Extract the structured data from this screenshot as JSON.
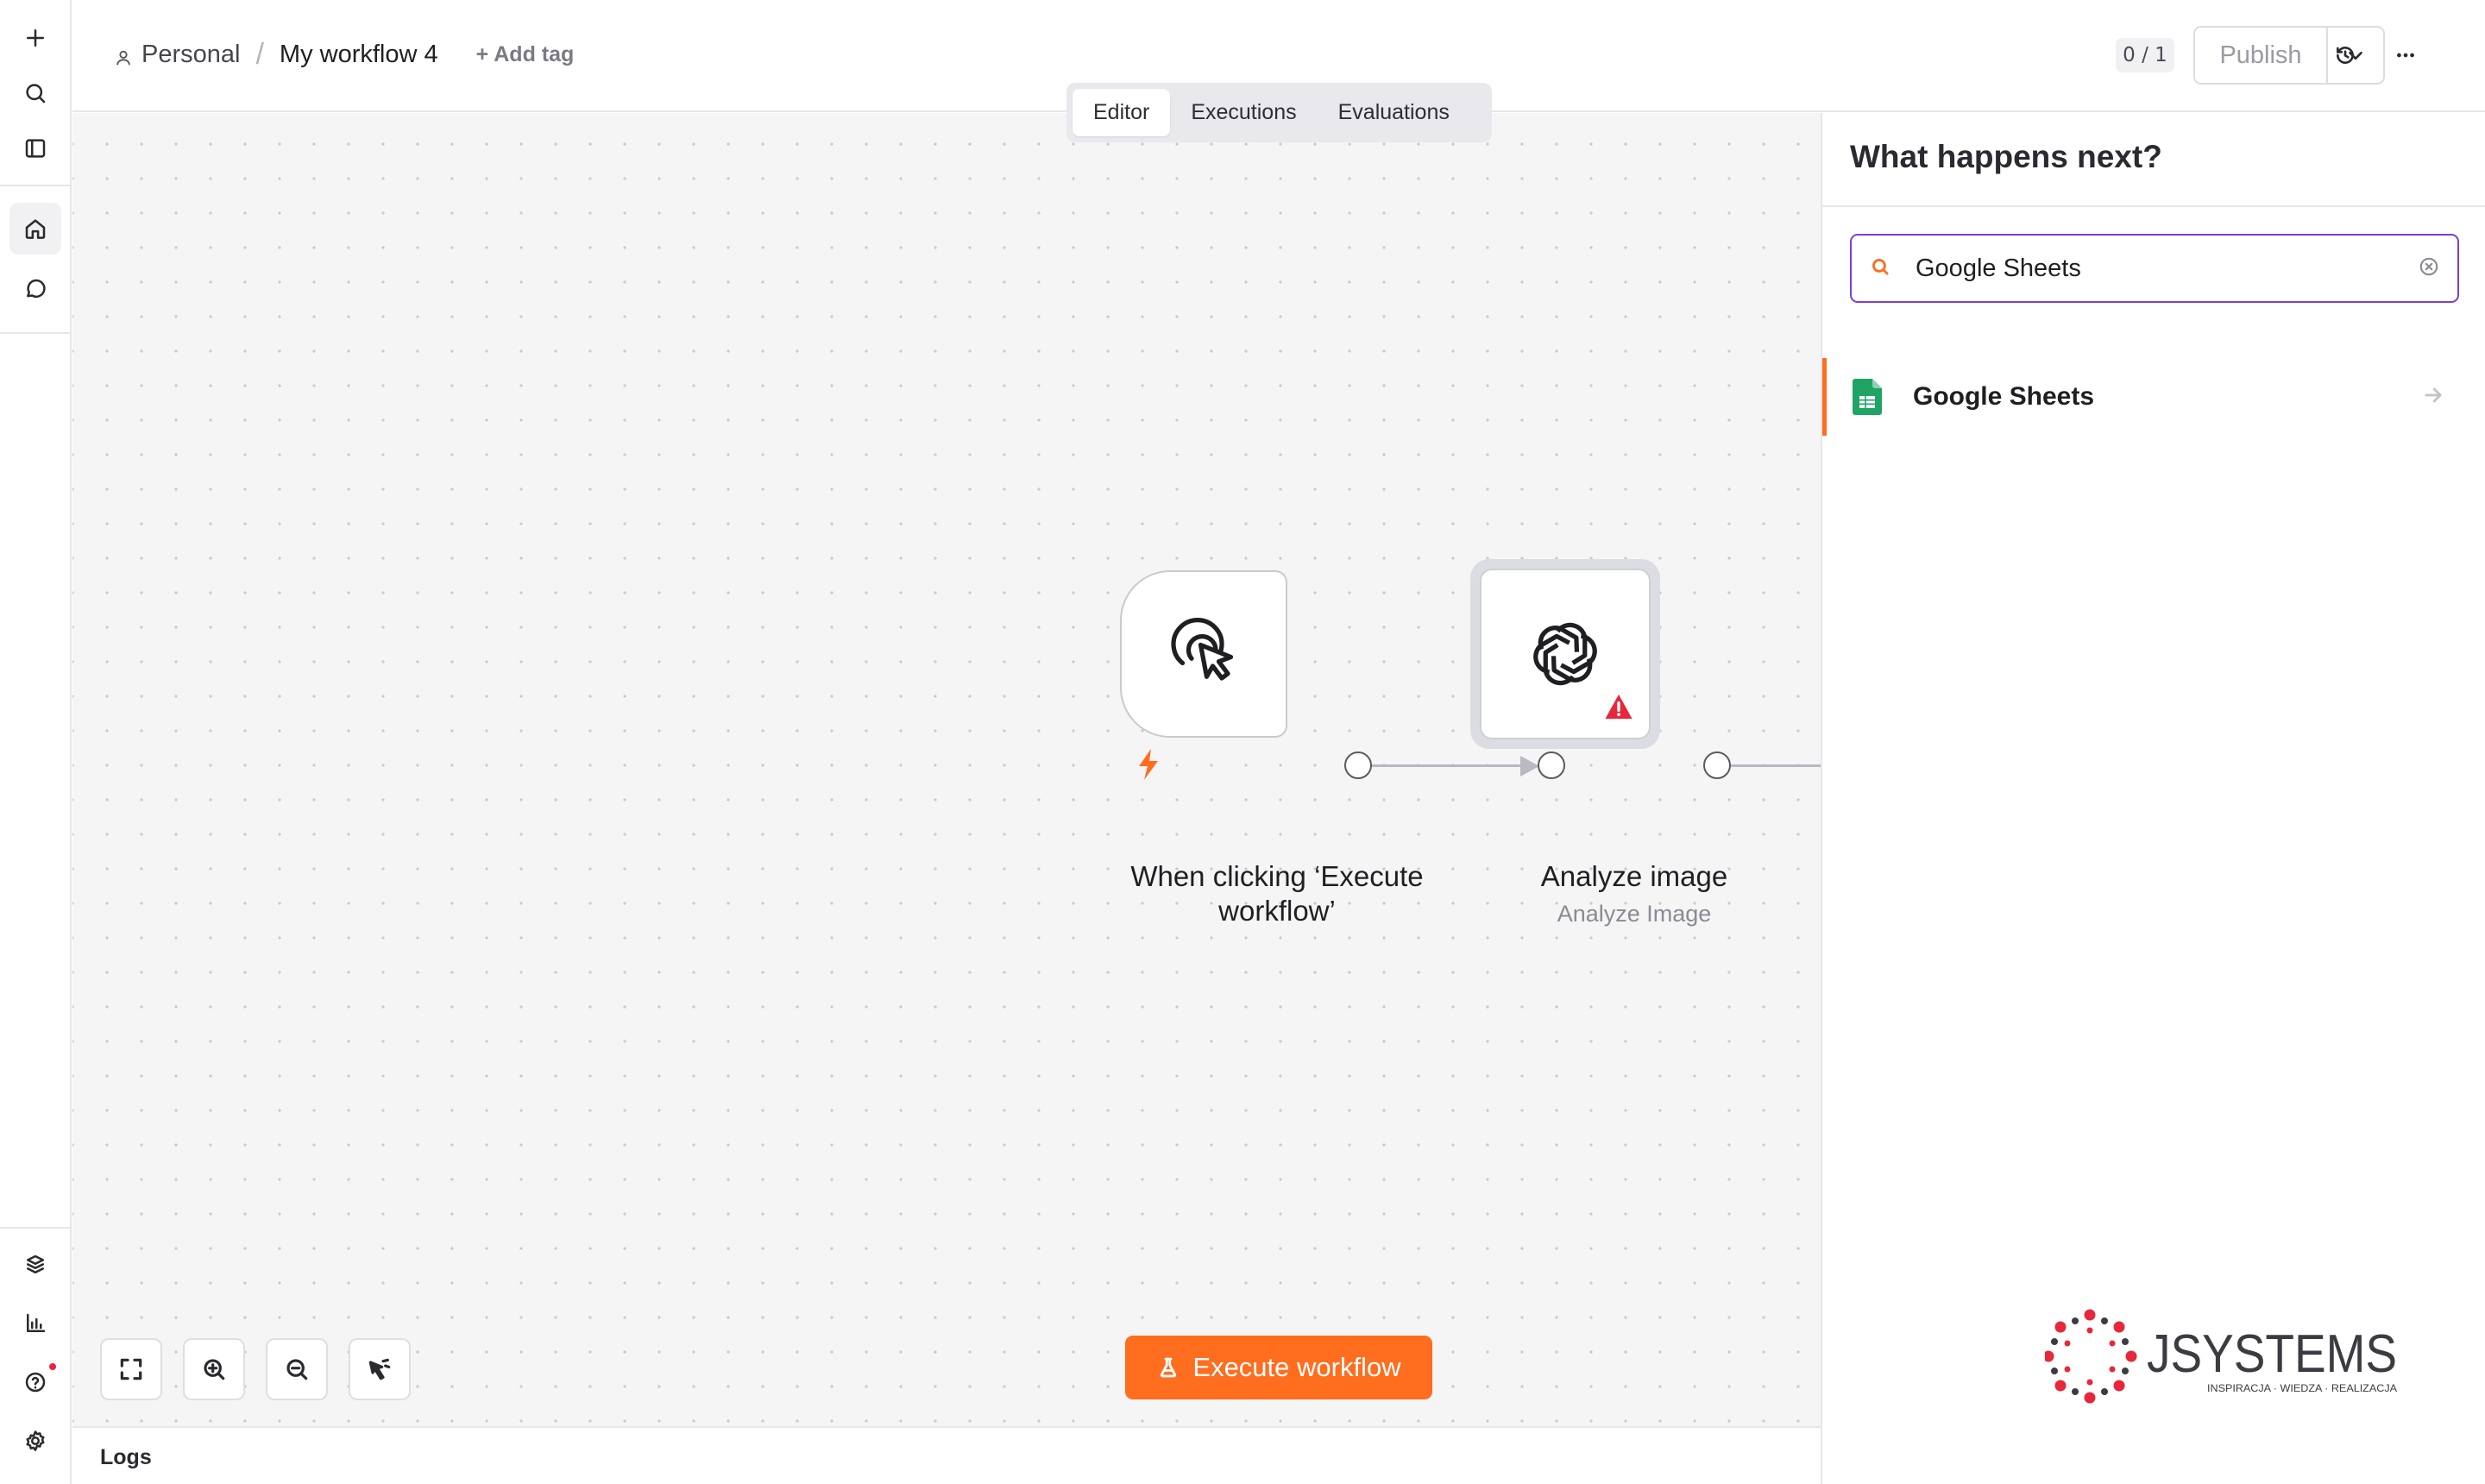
{
  "header": {
    "project": "Personal",
    "separator": "/",
    "workflow_name": "My workflow 4",
    "add_tag": "+ Add tag",
    "tabs": [
      {
        "label": "Editor",
        "active": true
      },
      {
        "label": "Executions",
        "active": false
      },
      {
        "label": "Evaluations",
        "active": false
      }
    ],
    "version_counter": "0 / 1",
    "publish_label": "Publish"
  },
  "sidebar": {
    "top_icons": [
      "plus-icon",
      "search-icon",
      "sidebar-toggle-icon",
      "home-icon",
      "chat-icon"
    ],
    "bottom_icons": [
      "templates-icon",
      "insights-icon",
      "help-icon",
      "settings-icon"
    ]
  },
  "canvas": {
    "nodes": [
      {
        "title": "When clicking ‘Execute workflow’",
        "subtitle": "",
        "icon": "cursor-click-icon"
      },
      {
        "title": "Analyze image",
        "subtitle": "Analyze Image",
        "icon": "openai-icon",
        "warning": true
      }
    ],
    "execute_label": "Execute workflow",
    "tools": [
      "fit-view-icon",
      "zoom-in-icon",
      "zoom-out-icon",
      "tidy-up-icon"
    ]
  },
  "logs": {
    "label": "Logs"
  },
  "panel": {
    "title": "What happens next?",
    "search_value": "Google Sheets",
    "results": [
      {
        "label": "Google Sheets",
        "icon": "google-sheets-icon"
      }
    ]
  },
  "watermark": {
    "brand": "JSYSTEMS",
    "tagline": "INSPIRACJA · WIEDZA · REALIZACJA"
  },
  "colors": {
    "accent": "#ff6d1f",
    "search_border": "#7b3fd6",
    "warning": "#e8273b",
    "sheets_green": "#1fa463"
  }
}
